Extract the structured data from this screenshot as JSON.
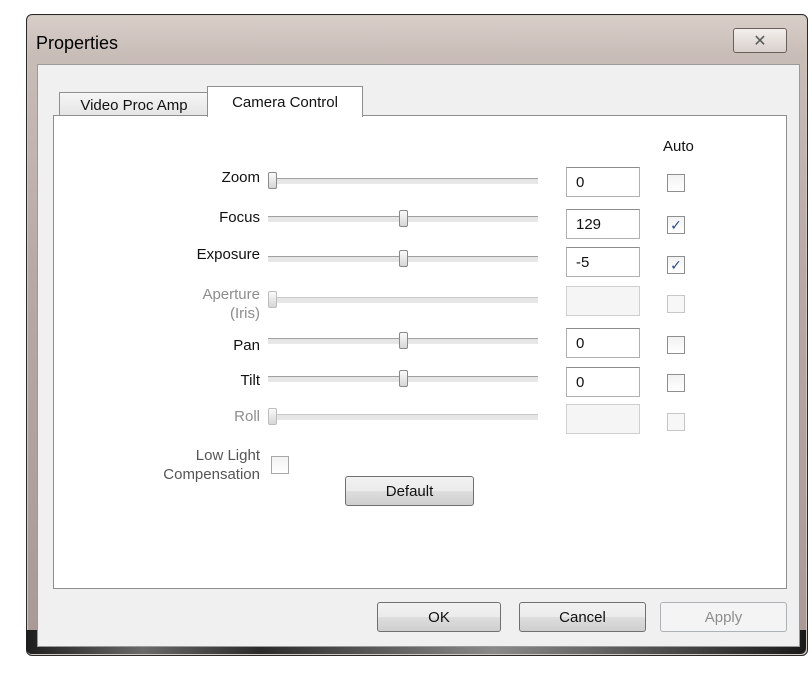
{
  "window": {
    "title": "Properties",
    "close_glyph": "✕"
  },
  "tabs": [
    {
      "label": "Video Proc Amp",
      "selected": false
    },
    {
      "label": "Camera Control",
      "selected": true
    }
  ],
  "auto_header": "Auto",
  "controls": {
    "zoom": {
      "label": "Zoom",
      "value": "0",
      "auto": false,
      "enabled": true,
      "slider_level": 0.0
    },
    "focus": {
      "label": "Focus",
      "value": "129",
      "auto": true,
      "enabled": true,
      "slider_level": 0.5
    },
    "exposure": {
      "label": "Exposure",
      "value": "-5",
      "auto": true,
      "enabled": true,
      "slider_level": 0.5
    },
    "aperture": {
      "label_line1": "Aperture",
      "label_line2": "(Iris)",
      "value": "",
      "auto": false,
      "enabled": false,
      "slider_level": 0.0
    },
    "pan": {
      "label": "Pan",
      "value": "0",
      "auto": false,
      "enabled": true,
      "slider_level": 0.5
    },
    "tilt": {
      "label": "Tilt",
      "value": "0",
      "auto": false,
      "enabled": true,
      "slider_level": 0.5
    },
    "roll": {
      "label": "Roll",
      "value": "",
      "auto": false,
      "enabled": false,
      "slider_level": 0.0
    }
  },
  "low_light": {
    "line1": "Low Light",
    "line2": "Compensation",
    "checked": false
  },
  "buttons": {
    "default": "Default",
    "ok": "OK",
    "cancel": "Cancel",
    "apply": "Apply"
  },
  "icons": {
    "close": "close-icon",
    "check": "checkmark-icon"
  }
}
